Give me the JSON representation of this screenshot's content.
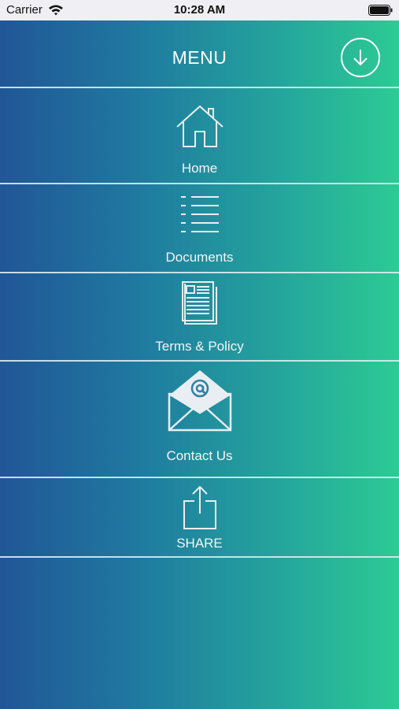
{
  "status_bar": {
    "carrier": "Carrier",
    "time": "10:28 AM"
  },
  "header": {
    "title": "MENU",
    "action_icon": "download-arrow-icon"
  },
  "menu_items": [
    {
      "label": "Home",
      "icon": "home-icon"
    },
    {
      "label": "Documents",
      "icon": "list-icon"
    },
    {
      "label": "Terms & Policy",
      "icon": "document-icon"
    },
    {
      "label": "Contact Us",
      "icon": "email-envelope-icon"
    },
    {
      "label": "SHARE",
      "icon": "share-icon"
    }
  ],
  "colors": {
    "gradient_start": "#215697",
    "gradient_end": "#2ccb94",
    "icon_stroke": "#e8eef2"
  }
}
